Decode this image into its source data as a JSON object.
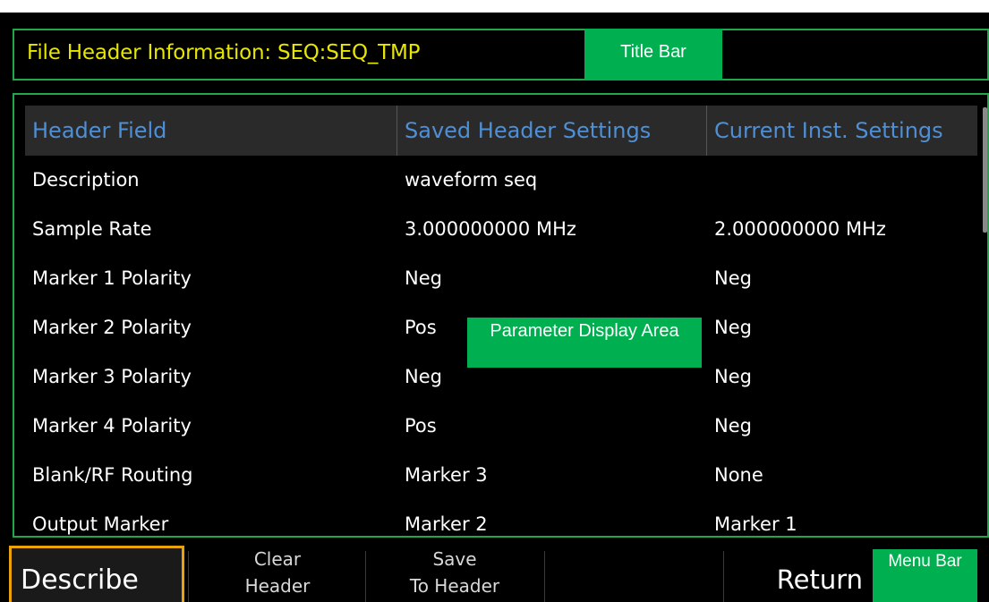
{
  "title_bar": {
    "title": "File Header Information: SEQ:SEQ_TMP",
    "label": "Title Bar"
  },
  "table": {
    "columns": [
      "Header Field",
      "Saved Header Settings",
      "Current Inst. Settings"
    ],
    "rows": [
      [
        "Description",
        "waveform seq",
        ""
      ],
      [
        "Sample Rate",
        "3.000000000 MHz",
        "2.000000000 MHz"
      ],
      [
        "Marker 1 Polarity",
        "Neg",
        "Neg"
      ],
      [
        "Marker 2 Polarity",
        "Pos",
        "Neg"
      ],
      [
        "Marker 3 Polarity",
        "Neg",
        "Neg"
      ],
      [
        "Marker 4 Polarity",
        "Pos",
        "Neg"
      ],
      [
        "Blank/RF Routing",
        "Marker 3",
        "None"
      ],
      [
        "Output Marker",
        "Marker 2",
        "Marker 1"
      ]
    ]
  },
  "param_area_label": "Parameter Display Area",
  "menu": {
    "describe": "Describe",
    "clear_line1": "Clear",
    "clear_line2": "Header",
    "save_line1": "Save",
    "save_line2": "To Header",
    "return": "Return",
    "menu_bar_label": "Menu Bar"
  },
  "colors": {
    "accent_green": "#00b050",
    "title_yellow": "#e6e600",
    "header_blue": "#4f8fd6",
    "focus_orange": "#e8a20c"
  }
}
